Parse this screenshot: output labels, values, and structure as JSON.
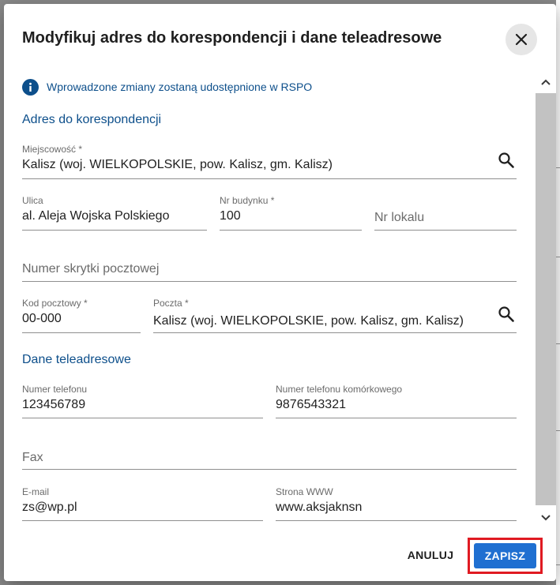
{
  "dialog": {
    "title": "Modyfikuj adres do korespondencji i dane teleadresowe",
    "info": "Wprowadzone zmiany zostaną udostępnione w RSPO"
  },
  "address": {
    "section_title": "Adres do korespondencji",
    "city": {
      "label": "Miejscowość *",
      "value": "Kalisz (woj. WIELKOPOLSKIE, pow. Kalisz, gm. Kalisz)"
    },
    "street": {
      "label": "Ulica",
      "value": "al. Aleja Wojska Polskiego"
    },
    "building_no": {
      "label": "Nr budynku *",
      "value": "100"
    },
    "apartment_no": {
      "placeholder": "Nr lokalu"
    },
    "po_box": {
      "placeholder": "Numer skrytki pocztowej"
    },
    "postal_code": {
      "label": "Kod pocztowy *",
      "value": "00-000"
    },
    "post_office": {
      "label": "Poczta *",
      "value": "Kalisz (woj. WIELKOPOLSKIE, pow. Kalisz, gm. Kalisz)"
    }
  },
  "contact": {
    "section_title": "Dane teleadresowe",
    "phone": {
      "label": "Numer telefonu",
      "value": "123456789"
    },
    "mobile": {
      "label": "Numer telefonu komórkowego",
      "value": "9876543321"
    },
    "fax": {
      "placeholder": "Fax"
    },
    "email": {
      "label": "E-mail",
      "value": "zs@wp.pl"
    },
    "website": {
      "label": "Strona WWW",
      "value": "www.aksjaknsn"
    }
  },
  "actions": {
    "cancel_label": "ANULUJ",
    "save_label": "ZAPISZ"
  },
  "icons": {
    "info": "info-icon",
    "close": "close-icon",
    "search": "search-icon"
  },
  "colors": {
    "accent": "#0d4f8b",
    "primary_button": "#1f6fd1",
    "highlight": "#e01a22"
  }
}
